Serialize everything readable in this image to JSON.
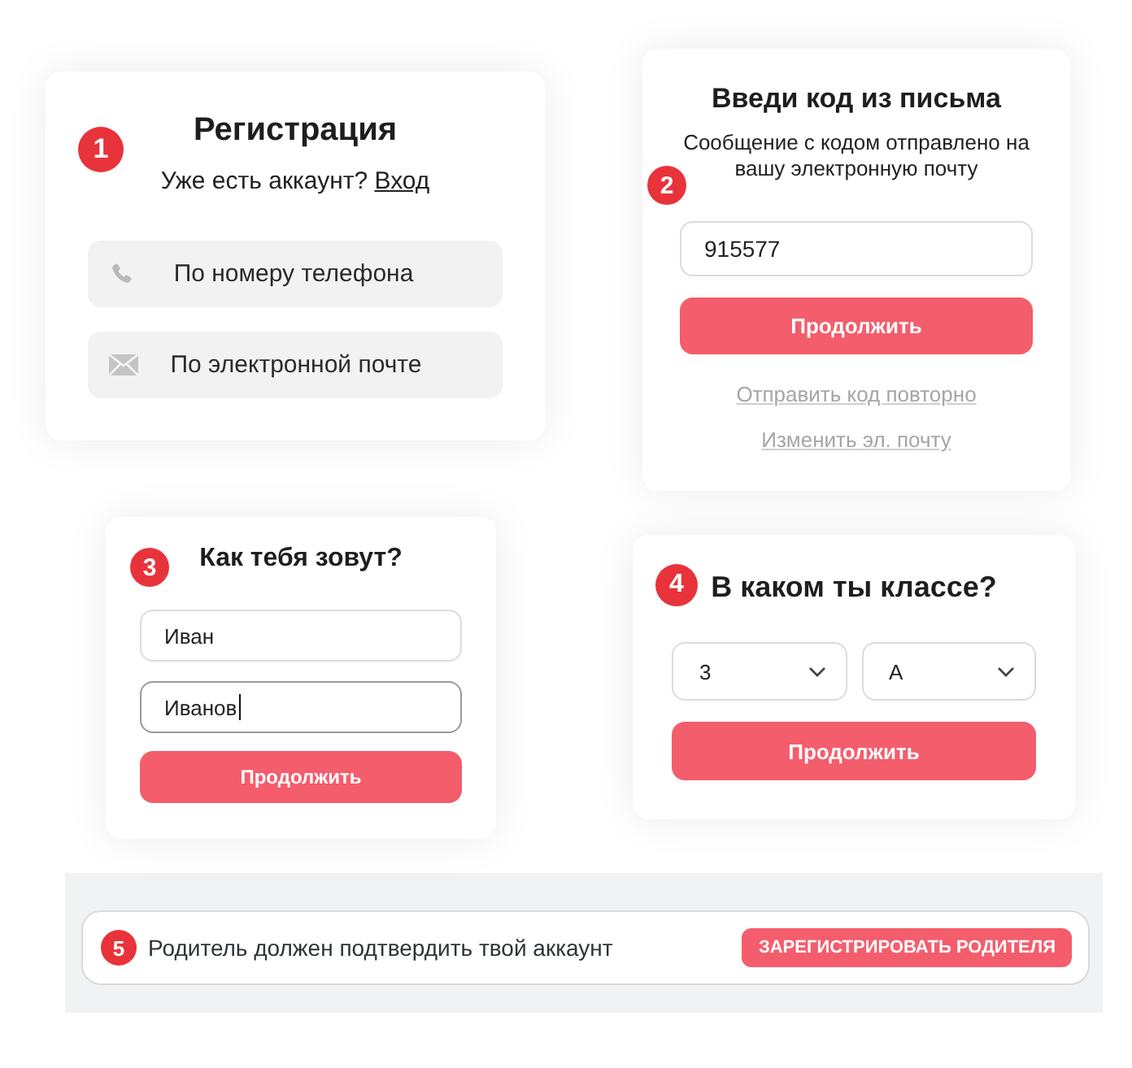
{
  "registration": {
    "step": "1",
    "title": "Регистрация",
    "prompt": "Уже есть аккаунт?",
    "login_link": "Вход",
    "options": [
      {
        "kind": "phone",
        "label": "По номеру телефона"
      },
      {
        "kind": "email",
        "label": "По электронной почте"
      }
    ]
  },
  "code_entry": {
    "step": "2",
    "title": "Введи код из письма",
    "message": "Сообщение с кодом отправлено на вашу электронную почту",
    "code_field": {
      "value": "915577"
    },
    "button": "Продолжить",
    "links": [
      "Отправить код повторно",
      "Изменить эл. почту"
    ]
  },
  "name_entry": {
    "step": "3",
    "title": "Как тебя зовут?",
    "fields": [
      {
        "value": "Иван",
        "focused": false
      },
      {
        "value": "Иванов",
        "focused": true
      }
    ],
    "button": "Продолжить"
  },
  "class_entry": {
    "step": "4",
    "title": "В каком ты классе?",
    "selects": [
      {
        "value": "3"
      },
      {
        "value": "А"
      }
    ],
    "button": "Продолжить"
  },
  "parent_banner": {
    "step": "5",
    "message": "Родитель должен подтвердить твой аккаунт",
    "button": "ЗАРЕГИСТРИРОВАТЬ РОДИТЕЛЯ"
  }
}
